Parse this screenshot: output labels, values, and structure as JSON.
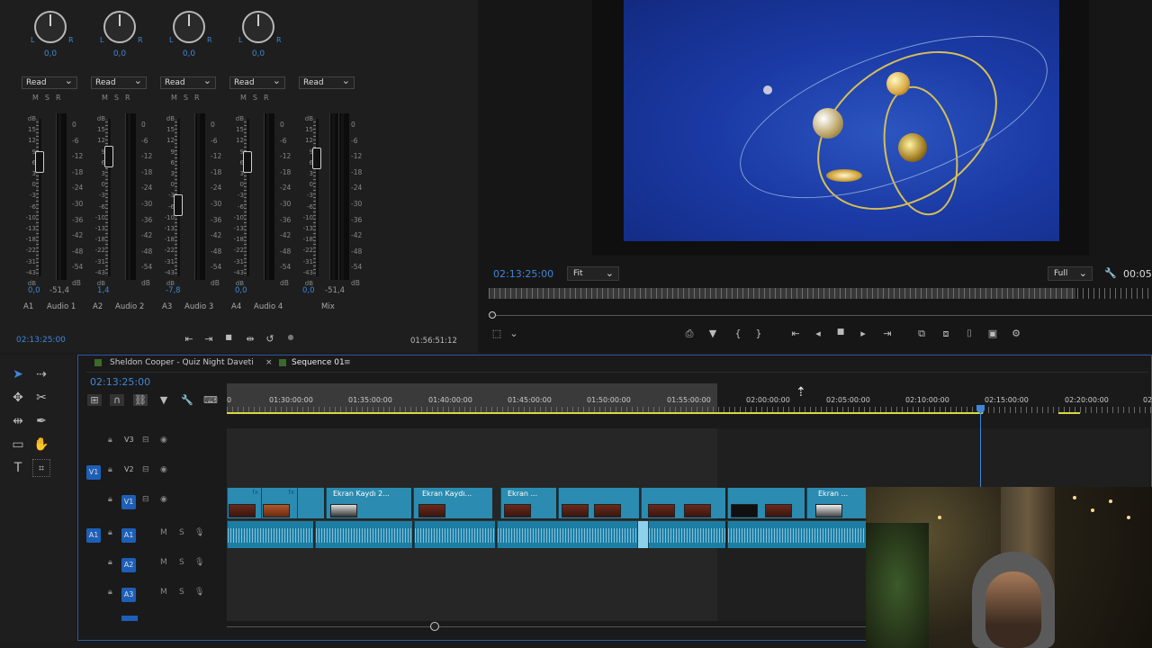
{
  "mixer": {
    "channels": [
      {
        "pan": "0,0",
        "auto": "Read",
        "val_l": "0,0",
        "val_r": "-51,4",
        "id": "A1",
        "name": "Audio 1"
      },
      {
        "pan": "0,0",
        "auto": "Read",
        "val_l": "1,4",
        "val_r": "",
        "id": "A2",
        "name": "Audio 2"
      },
      {
        "pan": "0,0",
        "auto": "Read",
        "val_l": "-7,8",
        "val_r": "",
        "id": "A3",
        "name": "Audio 3"
      },
      {
        "pan": "0,0",
        "auto": "Read",
        "val_l": "0,0",
        "val_r": "",
        "id": "A4",
        "name": "Audio 4"
      },
      {
        "pan": "",
        "auto": "Read",
        "val_l": "0,0",
        "val_r": "-51,4",
        "id": "",
        "name": "Mix"
      }
    ],
    "knob_l": "L",
    "knob_r": "R",
    "msr": "MSR",
    "db_scale": [
      "dB",
      "15",
      "12",
      "9",
      "6",
      "3",
      "0",
      "-3",
      "-6",
      "-10",
      "-13",
      "-18",
      "-22",
      "-31",
      "-43",
      "dB"
    ],
    "meter_scale": [
      "0",
      "-6",
      "-12",
      "-18",
      "-24",
      "-30",
      "-36",
      "-42",
      "-48",
      "-54",
      "dB"
    ],
    "timecode_left": "02:13:25:00",
    "timecode_right": "01:56:51:12"
  },
  "monitor": {
    "timecode": "02:13:25:00",
    "zoom": "Fit",
    "quality": "Full",
    "duration": "00:05"
  },
  "timeline": {
    "tabs": [
      "Sheldon Cooper - Quiz Night Daveti",
      "Sequence 01"
    ],
    "timecode": "02:13:25:00",
    "ruler": [
      "0",
      "01:30:00:00",
      "01:35:00:00",
      "01:40:00:00",
      "01:45:00:00",
      "01:50:00:00",
      "01:55:00:00",
      "02:00:00:00",
      "02:05:00:00",
      "02:10:00:00",
      "02:15:00:00",
      "02:20:00:00",
      "02"
    ],
    "tracks": [
      "V3",
      "V2",
      "V1",
      "A1",
      "A2",
      "A3"
    ],
    "src_v": "V1",
    "src_a": "A1",
    "mute": "M",
    "solo": "S",
    "clips": [
      "Ekran Kaydı 2...",
      "Ekran Kaydı...",
      "Ekran ...",
      "Ekran ..."
    ],
    "fx": "fx"
  },
  "colors": {
    "accent": "#3f86d8",
    "clip_video": "#2b8bb0",
    "clip_audio": "#1d7ea4",
    "playhead": "#3f86d8"
  }
}
